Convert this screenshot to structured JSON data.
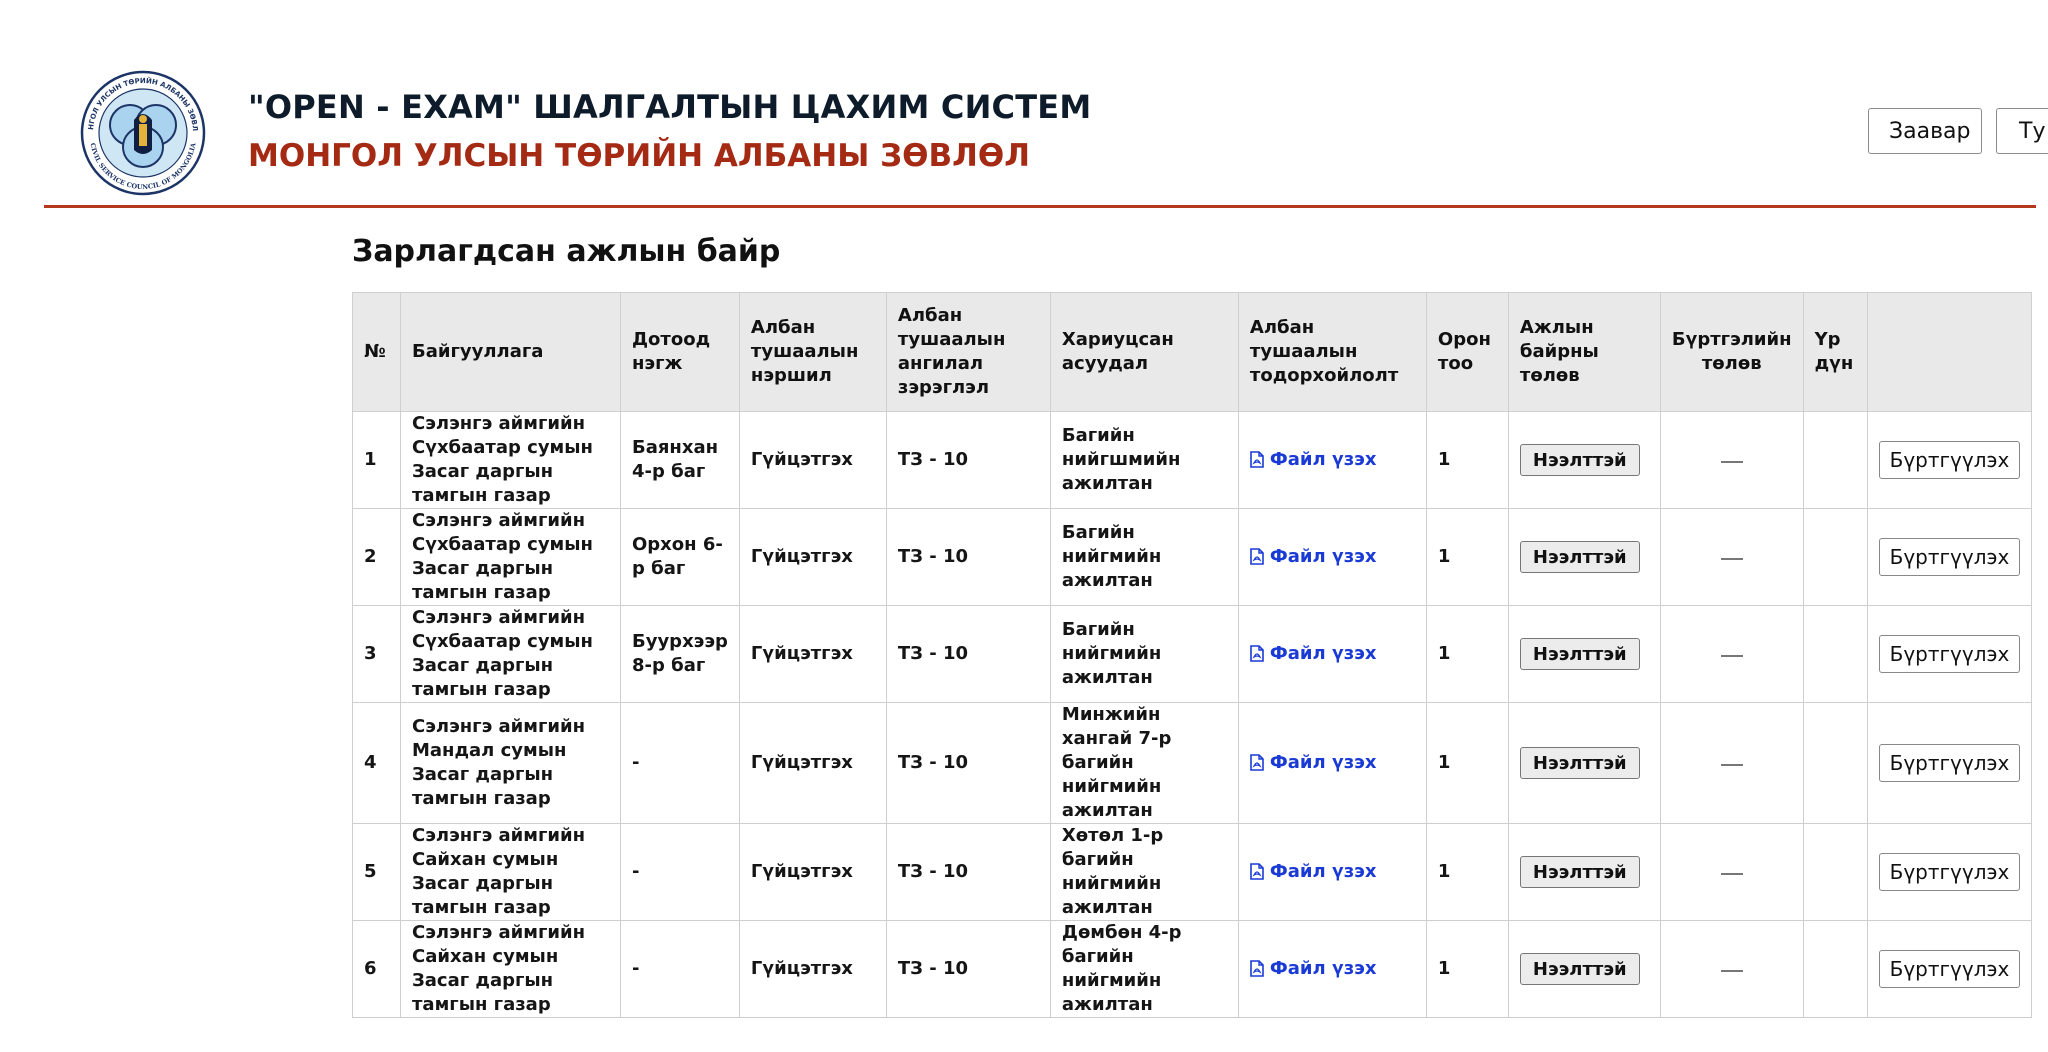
{
  "header": {
    "title_main": "\"OPEN - EXAM\" ШАЛГАЛТЫН ЦАХИМ СИСТЕМ",
    "title_sub": "МОНГОЛ УЛСЫН ТӨРИЙН АЛБАНЫ ЗӨВЛӨЛ",
    "logo_icon": "civil-service-council-seal",
    "logo_text_top": "МОНГОЛ УЛСЫН ТӨРИЙН АЛБАНЫ ЗӨВЛӨЛ",
    "logo_text_bottom": "CIVIL SERVICE COUNCIL OF MONGOLIA",
    "buttons": {
      "guide_label": "Заавар",
      "cut_label": "Ту"
    },
    "accent_color": "#b3391e"
  },
  "section_title": "Зарлагдсан ажлын байр",
  "table": {
    "headers": {
      "no": "№",
      "org": "Байгууллага",
      "unit": "Дотоод нэгж",
      "position": "Албан тушаалын нэршил",
      "category": "Албан тушаалын ангилал зэрэглэл",
      "responsibility": "Хариуцсан асуудал",
      "description": "Албан тушаалын тодорхойлолт",
      "seats": "Орон тоо",
      "status": "Ажлын байрны төлөв",
      "reg_status": "Бүртгэлийн төлөв",
      "result": "Үр дүн",
      "action": ""
    },
    "file_label": "Файл үзэх",
    "status_label": "Нээлттэй",
    "action_label": "Бүртгүүлэх",
    "rows": [
      {
        "no": "1",
        "org": "Сэлэнгэ аймгийн Сүхбаатар сумын Засаг даргын тамгын газар",
        "unit": "Баянхан 4-р баг",
        "position": "Гүйцэтгэх",
        "category": "ТЗ - 10",
        "responsibility": "Багийн нийгшмийн ажилтан",
        "seats": "1"
      },
      {
        "no": "2",
        "org": "Сэлэнгэ аймгийн Сүхбаатар сумын Засаг даргын тамгын газар",
        "unit": "Орхон 6-р баг",
        "position": "Гүйцэтгэх",
        "category": "ТЗ - 10",
        "responsibility": "Багийн нийгмийн ажилтан",
        "seats": "1"
      },
      {
        "no": "3",
        "org": "Сэлэнгэ аймгийн Сүхбаатар сумын Засаг даргын тамгын газар",
        "unit": "Буурхээр 8-р баг",
        "position": "Гүйцэтгэх",
        "category": "ТЗ - 10",
        "responsibility": "Багийн нийгмийн ажилтан",
        "seats": "1"
      },
      {
        "no": "4",
        "org": "Сэлэнгэ аймгийн Мандал сумын Засаг даргын тамгын газар",
        "unit": "-",
        "position": "Гүйцэтгэх",
        "category": "ТЗ - 10",
        "responsibility": "Минжийн хангай 7-р багийн нийгмийн ажилтан",
        "seats": "1"
      },
      {
        "no": "5",
        "org": "Сэлэнгэ аймгийн Сайхан сумын Засаг даргын тамгын газар",
        "unit": "-",
        "position": "Гүйцэтгэх",
        "category": "ТЗ - 10",
        "responsibility": "Хөтөл 1-р багийн нийгмийн ажилтан",
        "seats": "1"
      },
      {
        "no": "6",
        "org": "Сэлэнгэ аймгийн Сайхан сумын Засаг даргын тамгын газар",
        "unit": "-",
        "position": "Гүйцэтгэх",
        "category": "ТЗ - 10",
        "responsibility": "Дөмбөн 4-р багийн нийгмийн ажилтан",
        "seats": "1"
      }
    ]
  }
}
